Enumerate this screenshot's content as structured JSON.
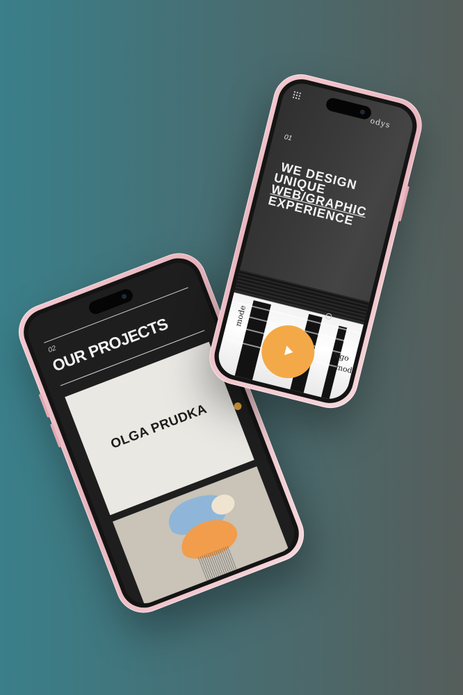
{
  "mockup_back": {
    "logo": "odys",
    "slide_number": "01",
    "headline": [
      "WE DESIGN",
      "UNIQUE",
      "WEB/GRAPHIC",
      "EXPERIENCE"
    ],
    "glitch_words": [
      "Ngo",
      "mod",
      "mode"
    ],
    "play_icon": "play-icon",
    "accent_color": "#f4a948"
  },
  "mockup_front": {
    "section_number": "02",
    "section_title": "OUR PROJECTS",
    "project_brand": "OLGA PRUDKA",
    "brand_dot_color": "#e2a53c"
  },
  "colors": {
    "phone_frame": "#e9b4bd",
    "background_left": "#3a7f8a",
    "background_right": "#555e5b"
  }
}
